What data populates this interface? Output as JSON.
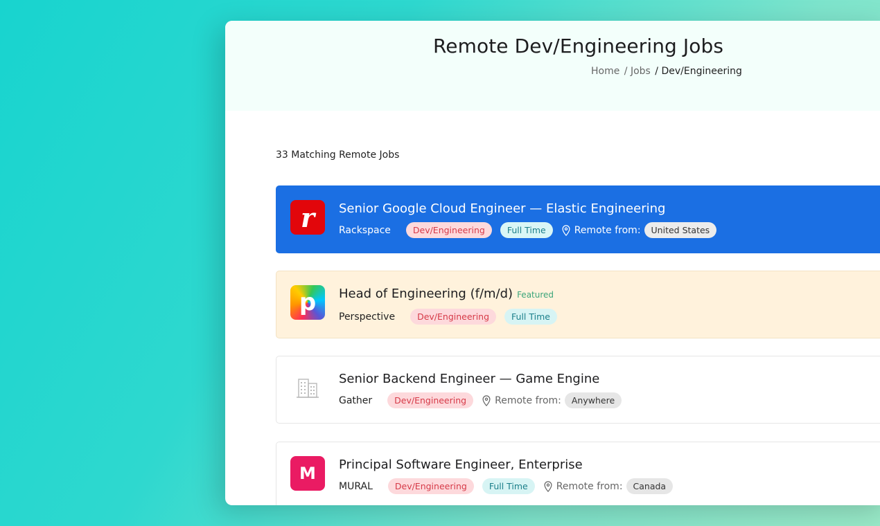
{
  "header": {
    "title": "Remote Dev/Engineering Jobs",
    "breadcrumbs": [
      "Home",
      "/ Jobs",
      "/ Dev/Engineering"
    ]
  },
  "results": {
    "count_text": "33 Matching Remote Jobs"
  },
  "jobs": [
    {
      "title": "Senior Google Cloud Engineer — Elastic Engineering",
      "company": "Rackspace",
      "category": "Dev/Engineering",
      "type": "Full Time",
      "remote_label": "Remote from:",
      "location": "United States",
      "logo_letter": "r"
    },
    {
      "title": "Head of Engineering (f/m/d)",
      "featured": "Featured",
      "company": "Perspective",
      "category": "Dev/Engineering",
      "type": "Full Time",
      "logo_letter": "p"
    },
    {
      "title": "Senior Backend Engineer — Game Engine",
      "company": "Gather",
      "category": "Dev/Engineering",
      "remote_label": "Remote from:",
      "location": "Anywhere"
    },
    {
      "title": "Principal Software Engineer, Enterprise",
      "company": "MURAL",
      "category": "Dev/Engineering",
      "type": "Full Time",
      "remote_label": "Remote from:",
      "location": "Canada",
      "logo_letter": "M"
    }
  ],
  "colors": {
    "highlight_blue": "#1b6fe3",
    "featured_cream": "#fff2dc",
    "category_pill": "#fdd9dc",
    "type_pill": "#d7f4f4"
  }
}
